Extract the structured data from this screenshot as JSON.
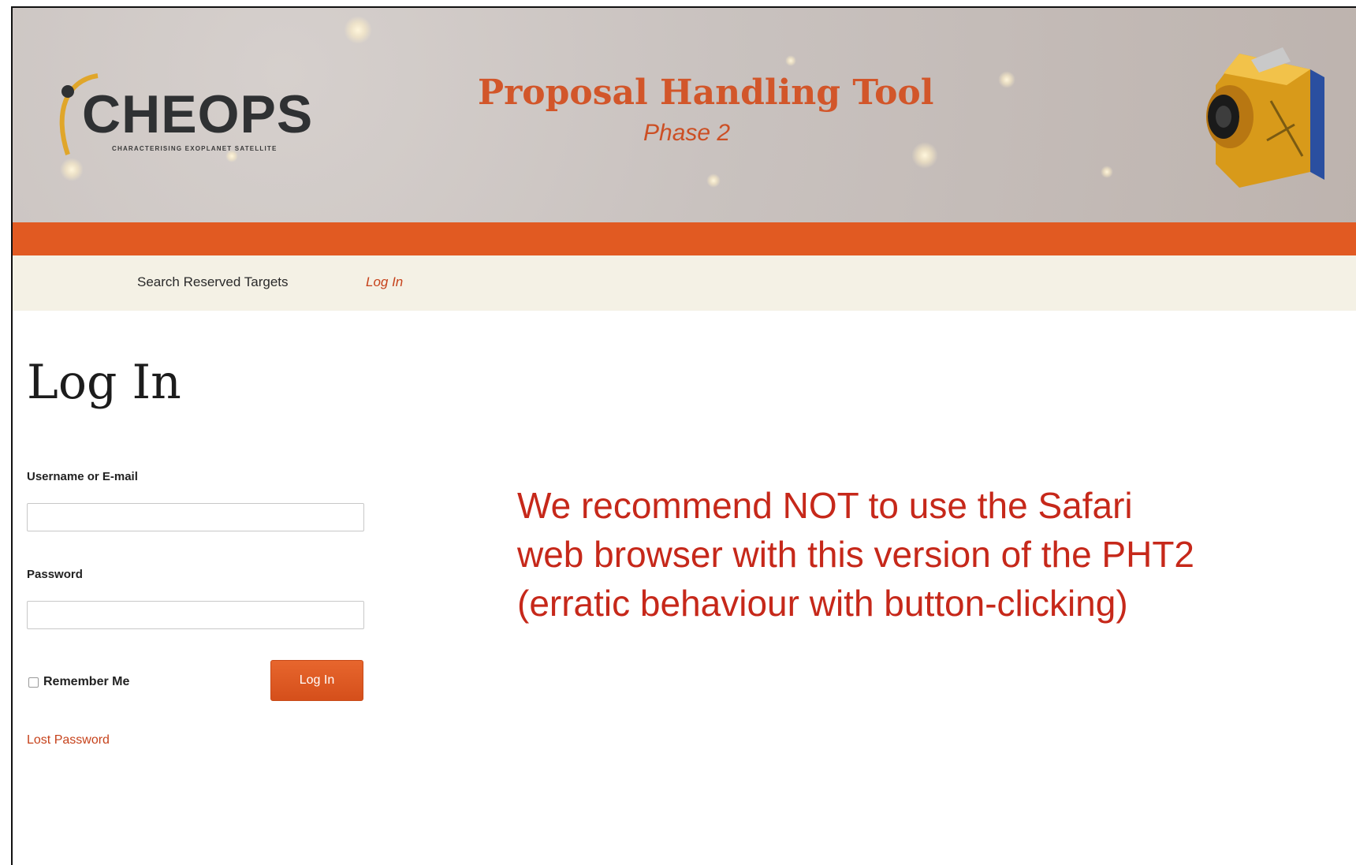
{
  "header": {
    "logo_text": "CHEOPS",
    "logo_subtitle": "CHARACTERISING EXOPLANET SATELLITE",
    "title": "Proposal Handling Tool",
    "subtitle": "Phase 2",
    "accent_color": "#e15a22",
    "title_color": "#d2562a"
  },
  "nav": {
    "items": [
      {
        "label": "Search Reserved Targets"
      },
      {
        "label": "Log In"
      }
    ]
  },
  "login": {
    "heading": "Log In",
    "username_label": "Username or E-mail",
    "username_value": "",
    "password_label": "Password",
    "password_value": "",
    "remember_label": "Remember Me",
    "remember_checked": false,
    "submit_label": "Log In",
    "lost_password_label": "Lost Password"
  },
  "notice": {
    "lines": [
      "We recommend NOT to use the Safari",
      "web browser with this version of the PHT2",
      "(erratic behaviour with button-clicking)"
    ],
    "color": "#c6281a"
  },
  "icons": {
    "logo": "cheops-logo-icon",
    "satellite": "satellite-icon",
    "checkbox": "checkbox-icon"
  }
}
